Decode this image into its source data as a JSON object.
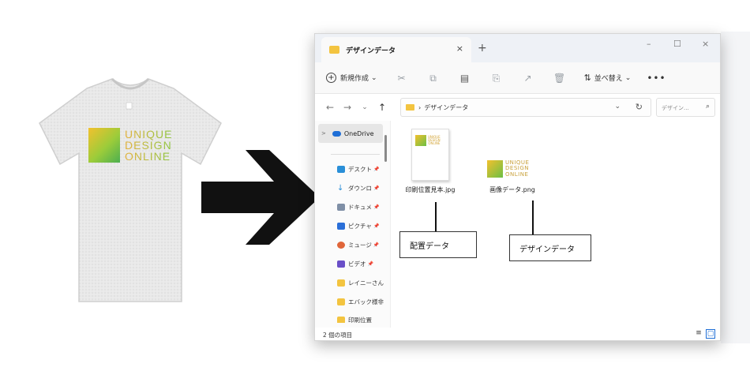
{
  "tshirt": {
    "logo_lines": [
      "UNIQUE",
      "DESIGN",
      "ONLINE"
    ]
  },
  "window": {
    "tab_title": "デザインデータ",
    "tab_close": "×",
    "new_tab": "+",
    "minimize": "–",
    "maximize": "☐",
    "close": "×"
  },
  "toolbar": {
    "new_label": "新規作成",
    "new_caret": "⌄",
    "sort_label": "並べ替え",
    "sort_caret": "⌄",
    "more": "•••"
  },
  "address": {
    "back": "←",
    "forward": "→",
    "recent": "⌄",
    "up": "↑",
    "separator": "›",
    "path": "デザインデータ",
    "dropdown": "⌄",
    "refresh": "↻",
    "search_placeholder": "デザイン...",
    "search_icon": "⌕"
  },
  "sidebar": {
    "expand": ">",
    "onedrive_label": "OneDrive",
    "pin": "📌",
    "items": [
      {
        "label": "デスクト",
        "color": "#2a8fd8",
        "pinned": true
      },
      {
        "label": "ダウンロ",
        "color": "#2a8fd8",
        "pinned": true
      },
      {
        "label": "ドキュメ",
        "color": "#7f8fa6",
        "pinned": true
      },
      {
        "label": "ピクチャ",
        "color": "#2a6fd8",
        "pinned": true
      },
      {
        "label": "ミュージ",
        "color": "#e0663a",
        "pinned": true
      },
      {
        "label": "ビデオ",
        "color": "#6a4fc8",
        "pinned": true
      },
      {
        "label": "レイニーさん",
        "color": "#f3c440",
        "pinned": false
      },
      {
        "label": "エバック様非",
        "color": "#f3c440",
        "pinned": false
      },
      {
        "label": "印刷位置",
        "color": "#f3c440",
        "pinned": false
      }
    ]
  },
  "files": [
    {
      "name": "印刷位置見本.jpg",
      "type": "jpg"
    },
    {
      "name": "画像データ.png",
      "type": "png"
    }
  ],
  "status": {
    "item_count": "2 個の項目"
  },
  "callouts": {
    "layout_label": "配置データ",
    "design_label": "デザインデータ"
  },
  "colors": {
    "folder": "#f3c440",
    "accent": "#1e6ed6",
    "logo_yellow": "#f2c12e",
    "logo_green": "#6cbf44"
  }
}
